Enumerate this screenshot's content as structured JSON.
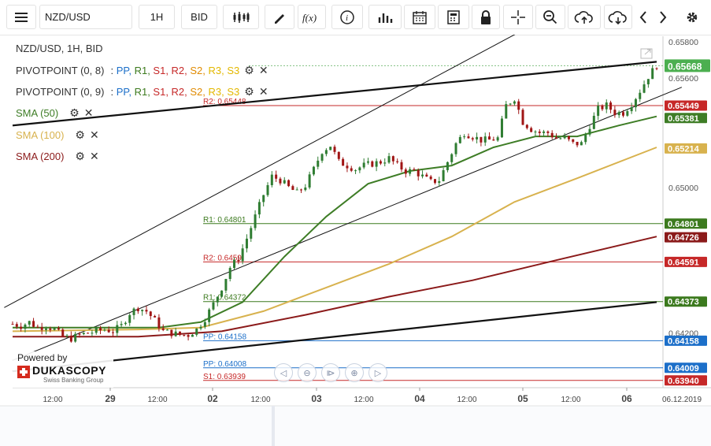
{
  "toolbar": {
    "instrument": "NZD/USD",
    "period": "1H",
    "side": "BID",
    "icons": [
      "menu-icon",
      "candles-icon",
      "draw-pen-icon",
      "function-icon",
      "info-icon",
      "bar-chart-icon",
      "calendar-icon",
      "calculator-icon",
      "lock-icon",
      "crosshair-icon",
      "zoom-icon",
      "upload-cloud-icon",
      "download-cloud-icon",
      "chevron-left-icon",
      "chevron-right-icon",
      "gear-icon"
    ]
  },
  "legend": {
    "title": "NZD/USD, 1H, BID",
    "pivot1_name": "PIVOTPOINT (0, 8)",
    "pivot2_name": "PIVOTPOINT (0, 9)",
    "pivot_sep": ":",
    "pivot_comps": [
      "PP",
      "R1",
      "S1",
      "R2",
      "S2",
      "R3",
      "S3"
    ],
    "sma50": "SMA (50)",
    "sma100": "SMA (100)",
    "sma200": "SMA (200)"
  },
  "colors": {
    "pp": "#1c6fc9",
    "r1": "#3c7a1e",
    "s1": "#c62828",
    "r2": "#c62828",
    "s2": "#e08a00",
    "r3": "#e3b800",
    "s3": "#e3b800",
    "sma50": "#3e7d26",
    "sma100": "#d8b24e",
    "sma200": "#8b1a1a",
    "up": "#2f7d32",
    "down": "#a01515",
    "last": "#4caf50"
  },
  "branding": {
    "powered": "Powered by",
    "brand": "DUKASCOPY",
    "tagline": "Swiss Banking Group"
  },
  "chart_data": {
    "type": "candlestick",
    "ylim": [
      0.639,
      0.6583
    ],
    "y_ticks": [
      "0.65800",
      "0.65600",
      "0.65000",
      "0.64200"
    ],
    "x_tick_labels": [
      "12:00",
      "29",
      "12:00",
      "02",
      "12:00",
      "03",
      "12:00",
      "04",
      "12:00",
      "05",
      "12:00",
      "06",
      "06.12.2019"
    ],
    "last_price": "0.65668",
    "price_badges": [
      {
        "value": "0.65668",
        "kind": "last"
      },
      {
        "value": "0.65449",
        "kind": "r2"
      },
      {
        "value": "0.65381",
        "kind": "sma50"
      },
      {
        "value": "0.65214",
        "kind": "sma100"
      },
      {
        "value": "0.64801",
        "kind": "r1"
      },
      {
        "value": "0.64726",
        "kind": "sma200"
      },
      {
        "value": "0.64591",
        "kind": "r2"
      },
      {
        "value": "0.64373",
        "kind": "r1"
      },
      {
        "value": "0.64158",
        "kind": "pp"
      },
      {
        "value": "0.64009",
        "kind": "pp"
      },
      {
        "value": "0.63940",
        "kind": "s1"
      }
    ],
    "pivot_levels": [
      {
        "label": "R2: 0.65448",
        "y": 0.65449,
        "x_start": "03 00:00",
        "kind": "r2"
      },
      {
        "label": "R1: 0.64801",
        "y": 0.64801,
        "x_start": "02 00:00",
        "kind": "r1"
      },
      {
        "label": "R2: 0.6459",
        "y": 0.64591,
        "x_start": "02 00:00",
        "kind": "r2"
      },
      {
        "label": "R1: 0.64372",
        "y": 0.64373,
        "x_start": "02 00:00",
        "kind": "r1"
      },
      {
        "label": "PP: 0.64158",
        "y": 0.64158,
        "x_start": "02 00:00",
        "kind": "pp"
      },
      {
        "label": "PP: 0.64008",
        "y": 0.64009,
        "x_start": "02 00:00",
        "kind": "pp"
      },
      {
        "label": "S1: 0.63939",
        "y": 0.6394,
        "x_start": "02 00:00",
        "kind": "s1"
      }
    ],
    "close_path": [
      [
        0,
        0.6425
      ],
      [
        2,
        0.6424
      ],
      [
        4,
        0.6426
      ],
      [
        6,
        0.6423
      ],
      [
        8,
        0.6424
      ],
      [
        10,
        0.6422
      ],
      [
        12,
        0.6418
      ],
      [
        14,
        0.6417
      ],
      [
        16,
        0.6419
      ],
      [
        18,
        0.642
      ],
      [
        20,
        0.6421
      ],
      [
        22,
        0.6422
      ],
      [
        24,
        0.6421
      ],
      [
        26,
        0.6424
      ],
      [
        28,
        0.6431
      ],
      [
        30,
        0.6434
      ],
      [
        32,
        0.6432
      ],
      [
        34,
        0.6427
      ],
      [
        36,
        0.6421
      ],
      [
        38,
        0.642
      ],
      [
        40,
        0.6419
      ],
      [
        42,
        0.6419
      ],
      [
        44,
        0.6422
      ],
      [
        46,
        0.6428
      ],
      [
        48,
        0.6436
      ],
      [
        50,
        0.6445
      ],
      [
        52,
        0.6456
      ],
      [
        54,
        0.6461
      ],
      [
        56,
        0.6472
      ],
      [
        58,
        0.6484
      ],
      [
        60,
        0.6496
      ],
      [
        62,
        0.6506
      ],
      [
        64,
        0.6504
      ],
      [
        66,
        0.65
      ],
      [
        68,
        0.6497
      ],
      [
        70,
        0.6501
      ],
      [
        72,
        0.651
      ],
      [
        74,
        0.652
      ],
      [
        76,
        0.6523
      ],
      [
        78,
        0.6514
      ],
      [
        80,
        0.6512
      ],
      [
        82,
        0.651
      ],
      [
        84,
        0.6512
      ],
      [
        86,
        0.6513
      ],
      [
        88,
        0.6514
      ],
      [
        90,
        0.6516
      ],
      [
        92,
        0.6512
      ],
      [
        94,
        0.6509
      ],
      [
        96,
        0.6509
      ],
      [
        98,
        0.6506
      ],
      [
        100,
        0.6503
      ],
      [
        102,
        0.6504
      ],
      [
        104,
        0.6514
      ],
      [
        106,
        0.6524
      ],
      [
        108,
        0.653
      ],
      [
        110,
        0.6528
      ],
      [
        112,
        0.6526
      ],
      [
        114,
        0.6526
      ],
      [
        116,
        0.6527
      ],
      [
        118,
        0.6545
      ],
      [
        120,
        0.6549
      ],
      [
        122,
        0.6536
      ],
      [
        124,
        0.6532
      ],
      [
        126,
        0.653
      ],
      [
        128,
        0.653
      ],
      [
        130,
        0.6527
      ],
      [
        132,
        0.6527
      ],
      [
        134,
        0.6524
      ],
      [
        136,
        0.6524
      ],
      [
        138,
        0.6534
      ],
      [
        140,
        0.6543
      ],
      [
        142,
        0.6545
      ],
      [
        144,
        0.6541
      ],
      [
        146,
        0.6541
      ],
      [
        148,
        0.6546
      ],
      [
        150,
        0.6553
      ],
      [
        152,
        0.6561
      ],
      [
        154,
        0.6567
      ]
    ],
    "sma_paths": {
      "sma50": [
        [
          0,
          0.6423
        ],
        [
          20,
          0.6423
        ],
        [
          35,
          0.6423
        ],
        [
          45,
          0.6426
        ],
        [
          55,
          0.6437
        ],
        [
          65,
          0.6462
        ],
        [
          75,
          0.6484
        ],
        [
          85,
          0.6502
        ],
        [
          95,
          0.6509
        ],
        [
          105,
          0.6512
        ],
        [
          115,
          0.6522
        ],
        [
          125,
          0.6528
        ],
        [
          135,
          0.6528
        ],
        [
          145,
          0.6534
        ],
        [
          154,
          0.6539
        ]
      ],
      "sma100": [
        [
          0,
          0.6421
        ],
        [
          30,
          0.6422
        ],
        [
          45,
          0.6423
        ],
        [
          60,
          0.6432
        ],
        [
          75,
          0.6445
        ],
        [
          90,
          0.6458
        ],
        [
          105,
          0.6473
        ],
        [
          120,
          0.6492
        ],
        [
          135,
          0.6505
        ],
        [
          154,
          0.6522
        ]
      ],
      "sma200": [
        [
          0,
          0.6418
        ],
        [
          30,
          0.6418
        ],
        [
          50,
          0.6421
        ],
        [
          70,
          0.643
        ],
        [
          90,
          0.644
        ],
        [
          110,
          0.6449
        ],
        [
          130,
          0.646
        ],
        [
          154,
          0.6473
        ]
      ]
    },
    "trendlines": [
      {
        "from": [
          0,
          0.6405
        ],
        "to": [
          160,
          0.6555
        ],
        "style": "channel-lower-thin"
      },
      {
        "from": [
          -2,
          0.6434
        ],
        "to": [
          125,
          0.659
        ],
        "style": "channel-upper-thin"
      },
      {
        "from": [
          0,
          0.6534
        ],
        "to": [
          154,
          0.6569
        ],
        "style": "thick"
      },
      {
        "from": [
          0,
          0.6399
        ],
        "to": [
          154,
          0.6437
        ],
        "style": "thick"
      }
    ]
  }
}
